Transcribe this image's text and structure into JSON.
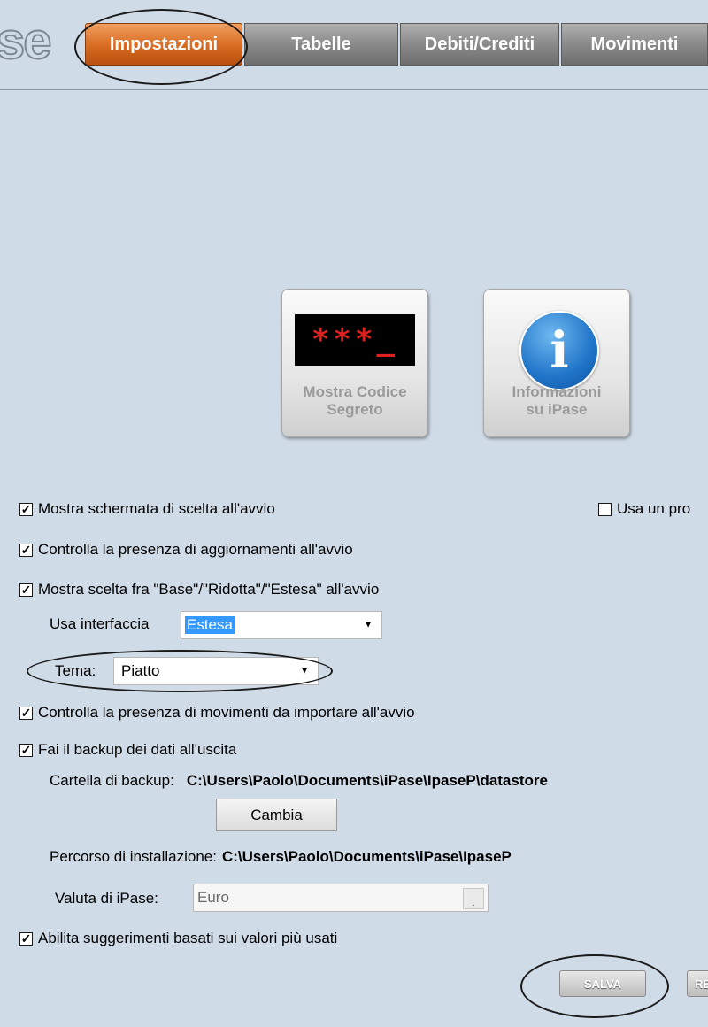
{
  "logo": {
    "text": "se"
  },
  "tabs": [
    {
      "label": "Impostazioni",
      "active": true
    },
    {
      "label": "Tabelle",
      "active": false
    },
    {
      "label": "Debiti/Crediti",
      "active": false
    },
    {
      "label": "Movimenti",
      "active": false
    }
  ],
  "buttons": {
    "secret_code": {
      "label": "Mostra Codice\nSegreto",
      "display": "***_"
    },
    "info": {
      "label": "Informazioni\nsu iPase",
      "icon": "info-icon"
    }
  },
  "options": {
    "show_choice_screen": {
      "label": "Mostra schermata di scelta all'avvio",
      "checked": true
    },
    "use_profile": {
      "label": "Usa un pro",
      "checked": false
    },
    "check_updates": {
      "label": "Controlla la presenza di aggiornamenti all'avvio",
      "checked": true
    },
    "show_interface_choice": {
      "label": "Mostra scelta fra \"Base\"/\"Ridotta\"/\"Estesa\" all'avvio",
      "checked": true
    },
    "interface": {
      "label": "Usa interfaccia",
      "value": "Estesa"
    },
    "theme": {
      "label": "Tema:",
      "value": "Piatto"
    },
    "check_movements": {
      "label": "Controlla la presenza di movimenti da importare all'avvio",
      "checked": true
    },
    "backup_on_exit": {
      "label": "Fai il backup dei dati all'uscita",
      "checked": true
    },
    "backup_folder": {
      "label": "Cartella di backup:",
      "value": "C:\\Users\\Paolo\\Documents\\iPase\\IpaseP\\datastore"
    },
    "change_button": "Cambia",
    "install_path": {
      "label": "Percorso di installazione:",
      "value": "C:\\Users\\Paolo\\Documents\\iPase\\IpaseP"
    },
    "currency": {
      "label": "Valuta di iPase:",
      "value": "Euro",
      "button": "."
    },
    "suggestions": {
      "label": "Abilita suggerimenti basati sui valori più usati",
      "checked": true
    }
  },
  "footer": {
    "save": "SALVA",
    "reset": "RE"
  },
  "colors": {
    "background": "#cfdbe7",
    "active_tab": "#d86a20",
    "tab": "#8a8a8a"
  }
}
